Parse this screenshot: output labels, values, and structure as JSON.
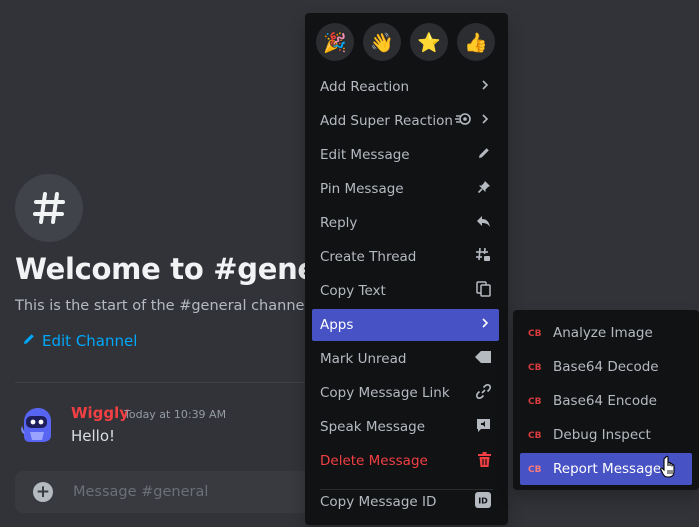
{
  "channel": {
    "icon": "#",
    "welcome_title": "Welcome to #general",
    "welcome_subtitle": "This is the start of the #general channel.",
    "edit_label": "Edit Channel"
  },
  "message": {
    "author": "Wiggly",
    "timestamp": "Today at 10:39 AM",
    "text": "Hello!"
  },
  "composer": {
    "placeholder": "Message #general"
  },
  "context_menu": {
    "reactions": [
      "🎉",
      "👋",
      "⭐",
      "👍"
    ],
    "items": [
      {
        "label": "Add Reaction",
        "icon": "chevron-right-icon"
      },
      {
        "label": "Add Super Reaction",
        "icon": "super-reaction-icon"
      },
      {
        "label": "Edit Message",
        "icon": "pencil-icon"
      },
      {
        "label": "Pin Message",
        "icon": "pin-icon"
      },
      {
        "label": "Reply",
        "icon": "reply-icon"
      },
      {
        "label": "Create Thread",
        "icon": "thread-icon"
      },
      {
        "label": "Copy Text",
        "icon": "copy-icon"
      },
      {
        "label": "Apps",
        "icon": "chevron-right-icon",
        "active": true
      },
      {
        "label": "Mark Unread",
        "icon": "mark-unread-icon"
      },
      {
        "label": "Copy Message Link",
        "icon": "link-icon"
      },
      {
        "label": "Speak Message",
        "icon": "speak-icon"
      },
      {
        "label": "Delete Message",
        "icon": "trash-icon",
        "danger": true
      },
      {
        "label": "Copy Message ID",
        "icon": "id-icon"
      }
    ]
  },
  "apps_submenu": {
    "items": [
      {
        "label": "Analyze Image"
      },
      {
        "label": "Base64 Decode"
      },
      {
        "label": "Base64 Encode"
      },
      {
        "label": "Debug Inspect"
      },
      {
        "label": "Report Message",
        "active": true
      }
    ]
  },
  "colors": {
    "background": "#313338",
    "menu_bg": "#111214",
    "accent": "#4752c4",
    "danger": "#f23f43",
    "link": "#00a8fc"
  }
}
